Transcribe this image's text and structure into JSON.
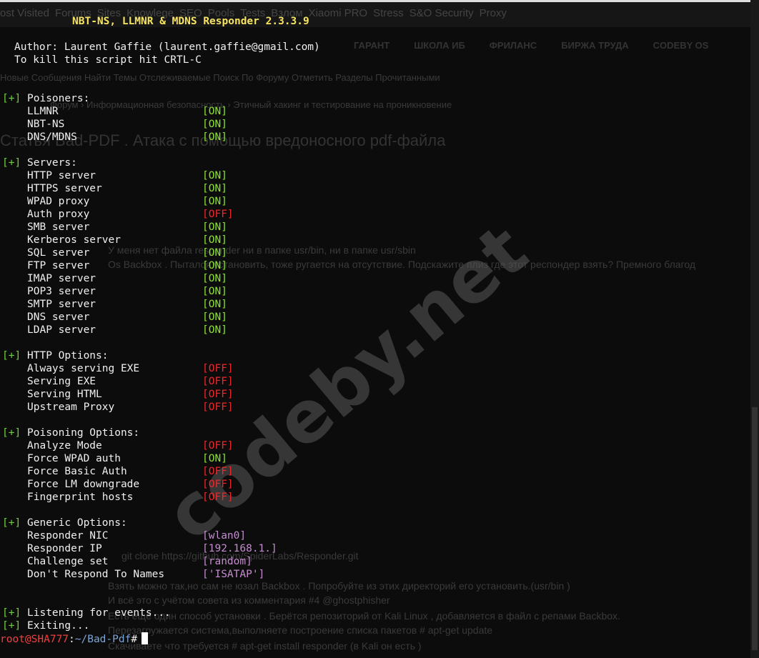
{
  "background": {
    "bookmarks": [
      "ost Visited",
      "Forums",
      "Sites",
      "Knowlege",
      "SEO",
      "Pools",
      "Tests",
      "Взлом",
      "Xiaomi PRO",
      "Stress",
      "S&O Security",
      "Proxy"
    ],
    "nav": [
      "ГАРАНТ",
      "ШКОЛА ИБ",
      "ФРИЛАНС",
      "БИРЖА ТРУДА",
      "CODEBY OS"
    ],
    "subnav": "Новые Сообщения   Найти Темы   Отслеживаемые   Поиск По Форуму   Отметить Разделы Прочитанными",
    "breadcrumb": "Форум  ›  Информационная безопасность  ›  Этичный хакинг и тестирование на проникновение",
    "thread_title": "Статья  Bad-PDF . Атака с помощью вредоносного pdf-файла",
    "post_lines": [
      "У меня нет файла responder ни в папке usr/bin, ни в папке usr/sbin",
      "Os Backbox . Пытался установить, тоже ругается на отсутствие. Подскажите плиз где этот респондер взять? Премного благод",
      "git clone https://github.com/SpiderLabs/Responder.git",
      "Взять можно так,но сам не юзал Backbox . Попробуйте из этих директорий его установить.(usr/bin )",
      "И всё это с учётом совета из комментария #4 @ghostphisher",
      "Есть ещё один способ установки . Берётся репозиторий от Kali Linux , добавляется в файл с репами Backbox.",
      "Перезагружается система,выполняете построение списка пакетов # apt-get update",
      "Скачиваете что требуется # apt-get install responder (в Kali он есть )"
    ],
    "watermark": "codeby.net"
  },
  "terminal": {
    "title": "NBT-NS, LLMNR & MDNS Responder 2.3.3.9",
    "author": "Author: Laurent Gaffie (laurent.gaffie@gmail.com)",
    "kill": "To kill this script hit CRTL-C",
    "plus": "[+]",
    "sections": [
      {
        "title": "Poisoners:",
        "items": [
          [
            "LLMNR",
            "[ON]",
            "on"
          ],
          [
            "NBT-NS",
            "[ON]",
            "on"
          ],
          [
            "DNS/MDNS",
            "[ON]",
            "on"
          ]
        ]
      },
      {
        "title": "Servers:",
        "items": [
          [
            "HTTP server",
            "[ON]",
            "on"
          ],
          [
            "HTTPS server",
            "[ON]",
            "on"
          ],
          [
            "WPAD proxy",
            "[ON]",
            "on"
          ],
          [
            "Auth proxy",
            "[OFF]",
            "off"
          ],
          [
            "SMB server",
            "[ON]",
            "on"
          ],
          [
            "Kerberos server",
            "[ON]",
            "on"
          ],
          [
            "SQL server",
            "[ON]",
            "on"
          ],
          [
            "FTP server",
            "[ON]",
            "on"
          ],
          [
            "IMAP server",
            "[ON]",
            "on"
          ],
          [
            "POP3 server",
            "[ON]",
            "on"
          ],
          [
            "SMTP server",
            "[ON]",
            "on"
          ],
          [
            "DNS server",
            "[ON]",
            "on"
          ],
          [
            "LDAP server",
            "[ON]",
            "on"
          ]
        ]
      },
      {
        "title": "HTTP Options:",
        "items": [
          [
            "Always serving EXE",
            "[OFF]",
            "off"
          ],
          [
            "Serving EXE",
            "[OFF]",
            "off"
          ],
          [
            "Serving HTML",
            "[OFF]",
            "off"
          ],
          [
            "Upstream Proxy",
            "[OFF]",
            "off"
          ]
        ]
      },
      {
        "title": "Poisoning Options:",
        "items": [
          [
            "Analyze Mode",
            "[OFF]",
            "off"
          ],
          [
            "Force WPAD auth",
            "[ON]",
            "on"
          ],
          [
            "Force Basic Auth",
            "[OFF]",
            "off"
          ],
          [
            "Force LM downgrade",
            "[OFF]",
            "off"
          ],
          [
            "Fingerprint hosts",
            "[OFF]",
            "off"
          ]
        ]
      },
      {
        "title": "Generic Options:",
        "items": [
          [
            "Responder NIC",
            "[wlan0]",
            "pur"
          ],
          [
            "Responder IP",
            "[192.168.1.]",
            "pur"
          ],
          [
            "Challenge set",
            "[random]",
            "pur"
          ],
          [
            "Don't Respond To Names",
            "['ISATAP']",
            "pur"
          ]
        ]
      }
    ],
    "listening": "Listening for events...",
    "exiting": "Exiting...",
    "prompt_user": "root@SHA777",
    "prompt_sep": ":",
    "prompt_path": "~/Bad-Pdf",
    "prompt_char": "#"
  },
  "colors": {
    "on": "#8ae234",
    "off": "#ef2929",
    "plus": "#6fd13a",
    "title": "#f7e463"
  }
}
